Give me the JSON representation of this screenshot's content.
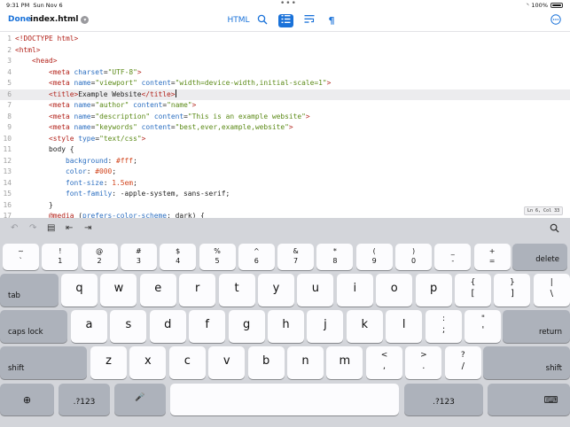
{
  "status_bar": {
    "time": "9:31 PM",
    "date": "Sun Nov 6",
    "battery": "100%"
  },
  "toolbar": {
    "done_label": "Done",
    "filename": "index.html",
    "html_label": "HTML",
    "accent_color": "#1a72d9"
  },
  "editor": {
    "lines": [
      {
        "n": "1",
        "html": "<span class=\"tg\">&lt;!DOCTYPE html&gt;</span>"
      },
      {
        "n": "2",
        "html": "<span class=\"tg\">&lt;html&gt;</span>"
      },
      {
        "n": "3",
        "html": "    <span class=\"tg\">&lt;head&gt;</span>"
      },
      {
        "n": "4",
        "html": "        <span class=\"tg\">&lt;meta</span> <span class=\"at\">charset</span>=<span class=\"st\">\"UTF-8\"</span><span class=\"tg\">&gt;</span>"
      },
      {
        "n": "5",
        "html": "        <span class=\"tg\">&lt;meta</span> <span class=\"at\">name</span>=<span class=\"st\">\"viewport\"</span> <span class=\"at\">content</span>=<span class=\"st\">\"width=device-width,initial-scale=1\"</span><span class=\"tg\">&gt;</span>"
      },
      {
        "n": "6",
        "html": "        <span class=\"tg\">&lt;title&gt;</span>Example Website<span class=\"tg\">&lt;/title&gt;</span><span class=\"cursor\"></span>"
      },
      {
        "n": "7",
        "html": "        <span class=\"tg\">&lt;meta</span> <span class=\"at\">name</span>=<span class=\"st\">\"author\"</span> <span class=\"at\">content</span>=<span class=\"st\">\"name\"</span><span class=\"tg\">&gt;</span>"
      },
      {
        "n": "8",
        "html": "        <span class=\"tg\">&lt;meta</span> <span class=\"at\">name</span>=<span class=\"st\">\"description\"</span> <span class=\"at\">content</span>=<span class=\"st\">\"This is an example website\"</span><span class=\"tg\">&gt;</span>"
      },
      {
        "n": "9",
        "html": "        <span class=\"tg\">&lt;meta</span> <span class=\"at\">name</span>=<span class=\"st\">\"keywords\"</span> <span class=\"at\">content</span>=<span class=\"st\">\"best,ever,example,website\"</span><span class=\"tg\">&gt;</span>"
      },
      {
        "n": "10",
        "html": "        <span class=\"tg\">&lt;style</span> <span class=\"at\">type</span>=<span class=\"st\">\"text/css\"</span><span class=\"tg\">&gt;</span>"
      },
      {
        "n": "11",
        "html": "        body {"
      },
      {
        "n": "12",
        "html": "            <span class=\"at\">background</span>: <span class=\"nm\">#fff</span>;"
      },
      {
        "n": "13",
        "html": "            <span class=\"at\">color</span>: <span class=\"nm\">#000</span>;"
      },
      {
        "n": "14",
        "html": "            <span class=\"at\">font-size</span>: <span class=\"nm\">1.5em</span>;"
      },
      {
        "n": "15",
        "html": "            <span class=\"at\">font-family</span>: -apple-system, sans-serif;"
      },
      {
        "n": "16",
        "html": "        }"
      },
      {
        "n": "17",
        "html": "        <span class=\"tg\">@media</span> (<span class=\"at\">prefers-color-scheme</span>: dark) {"
      }
    ],
    "current_line": 6,
    "position": "Ln 6, Col 33"
  },
  "keyboard": {
    "row1": [
      {
        "top": "~",
        "bot": "`"
      },
      {
        "top": "!",
        "bot": "1"
      },
      {
        "top": "@",
        "bot": "2"
      },
      {
        "top": "#",
        "bot": "3"
      },
      {
        "top": "$",
        "bot": "4"
      },
      {
        "top": "%",
        "bot": "5"
      },
      {
        "top": "^",
        "bot": "6"
      },
      {
        "top": "&",
        "bot": "7"
      },
      {
        "top": "*",
        "bot": "8"
      },
      {
        "top": "(",
        "bot": "9"
      },
      {
        "top": ")",
        "bot": "0"
      },
      {
        "top": "_",
        "bot": "-"
      },
      {
        "top": "+",
        "bot": "="
      }
    ],
    "delete_label": "delete",
    "tab_label": "tab",
    "row2": [
      "q",
      "w",
      "e",
      "r",
      "t",
      "y",
      "u",
      "i",
      "o",
      "p"
    ],
    "row2_sym": [
      {
        "top": "{",
        "bot": "["
      },
      {
        "top": "}",
        "bot": "]"
      },
      {
        "top": "|",
        "bot": "\\"
      }
    ],
    "caps_label": "caps lock",
    "row3": [
      "a",
      "s",
      "d",
      "f",
      "g",
      "h",
      "j",
      "k",
      "l"
    ],
    "row3_sym": [
      {
        "top": ":",
        "bot": ";"
      },
      {
        "top": "\"",
        "bot": "'"
      }
    ],
    "return_label": "return",
    "shift_label": "shift",
    "row4": [
      "z",
      "x",
      "c",
      "v",
      "b",
      "n",
      "m"
    ],
    "row4_sym": [
      {
        "top": "<",
        "bot": ","
      },
      {
        "top": ">",
        "bot": "."
      },
      {
        "top": "?",
        "bot": "/"
      }
    ],
    "numbers_label": ".?123"
  }
}
